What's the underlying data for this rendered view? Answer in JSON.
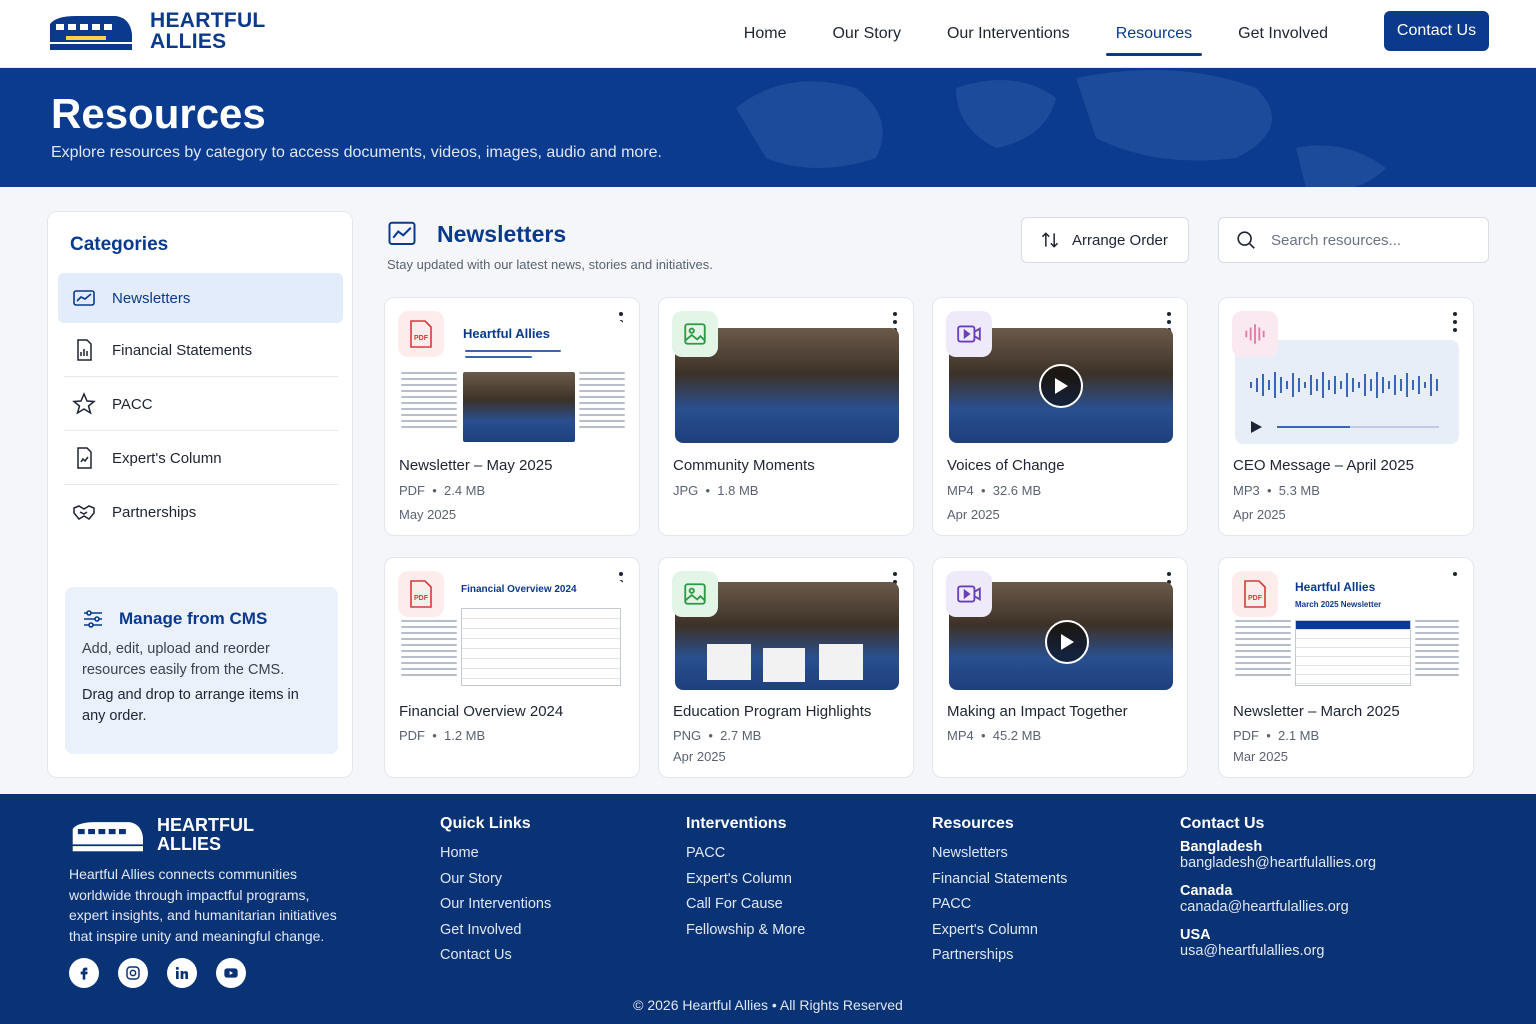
{
  "brand": {
    "name_line1": "HEARTFUL",
    "name_line2": "ALLIES"
  },
  "nav": {
    "items": [
      "Home",
      "Our Story",
      "Our Interventions",
      "Resources",
      "Get Involved"
    ],
    "active": "Resources",
    "contact_label": "Contact Us"
  },
  "hero": {
    "title": "Resources",
    "subtitle": "Explore resources by category to access documents, videos, images, audio and more."
  },
  "sidebar": {
    "title": "Categories",
    "items": [
      {
        "label": "Newsletters",
        "icon": "mail-chart-icon",
        "active": true
      },
      {
        "label": "Financial Statements",
        "icon": "report-icon"
      },
      {
        "label": "PACC",
        "icon": "star-icon"
      },
      {
        "label": "Expert's Column",
        "icon": "document-icon"
      },
      {
        "label": "Partnerships",
        "icon": "handshake-icon"
      }
    ],
    "cms": {
      "title": "Manage from CMS",
      "text1": "Add, edit, upload and reorder resources easily from the CMS.",
      "text2": "Drag and drop to arrange items in any order."
    }
  },
  "main": {
    "title": "Newsletters",
    "subtitle": "Stay updated with our latest news, stories and initiatives.",
    "arrange_label": "Arrange Order",
    "search_placeholder": "Search resources..."
  },
  "cards": [
    {
      "type": "pdf",
      "title": "Newsletter – May 2025",
      "format": "PDF",
      "size": "2.4 MB",
      "date": "May 2025",
      "doc_heading": "Heartful Allies"
    },
    {
      "type": "image",
      "title": "Community Moments",
      "format": "JPG",
      "size": "1.8 MB",
      "date": ""
    },
    {
      "type": "video",
      "title": "Voices of Change",
      "format": "MP4",
      "size": "32.6 MB",
      "date": "Apr 2025"
    },
    {
      "type": "audio",
      "title": "CEO Message – April 2025",
      "format": "MP3",
      "size": "5.3 MB",
      "date": "Apr 2025"
    },
    {
      "type": "pdf",
      "title": "Financial Overview 2024",
      "format": "PDF",
      "size": "1.2 MB",
      "date": "",
      "doc_heading": "Financial Overview 2024"
    },
    {
      "type": "image",
      "title": "Education Program Highlights",
      "format": "PNG",
      "size": "2.7 MB",
      "date": "Apr 2025"
    },
    {
      "type": "video",
      "title": "Making an Impact Together",
      "format": "MP4",
      "size": "45.2 MB",
      "date": ""
    },
    {
      "type": "pdf",
      "title": "Newsletter – March 2025",
      "format": "PDF",
      "size": "2.1 MB",
      "date": "Mar 2025",
      "doc_heading": "Heartful Allies",
      "doc_sub": "March 2025 Newsletter"
    }
  ],
  "footer": {
    "about": "Heartful Allies connects communities worldwide through impactful programs, expert insights, and humanitarian initiatives that inspire unity and meaningful change.",
    "social": [
      "facebook-icon",
      "instagram-icon",
      "linkedin-icon",
      "youtube-icon"
    ],
    "quick_links": {
      "title": "Quick Links",
      "items": [
        "Home",
        "Our Story",
        "Our Interventions",
        "Get Involved",
        "Contact Us"
      ]
    },
    "interventions": {
      "title": "Interventions",
      "items": [
        "PACC",
        "Expert's Column",
        "Call For Cause",
        "Fellowship & More"
      ]
    },
    "resources": {
      "title": "Resources",
      "items": [
        "Newsletters",
        "Financial Statements",
        "PACC",
        "Expert's Column",
        "Partnerships"
      ]
    },
    "contact": {
      "title": "Contact Us",
      "regions": [
        {
          "name": "Bangladesh",
          "email": "bangladesh@heartfulallies.org"
        },
        {
          "name": "Canada",
          "email": "canada@heartfulallies.org"
        },
        {
          "name": "USA",
          "email": "usa@heartfulallies.org"
        }
      ]
    },
    "copyright": "© 2026 Heartful Allies • All Rights Reserved"
  },
  "colors": {
    "primary": "#0b3a8c",
    "footer": "#0a3375",
    "active_bg": "#e2ecfa"
  }
}
